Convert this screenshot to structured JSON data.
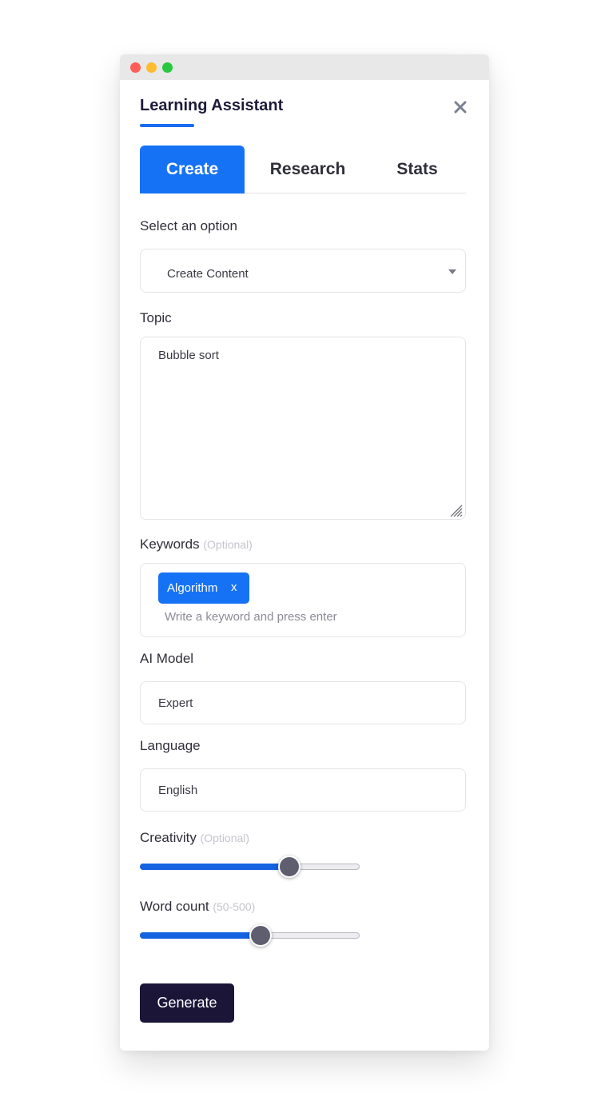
{
  "app": {
    "title": "Learning Assistant"
  },
  "tabs": [
    {
      "label": "Create",
      "active": true
    },
    {
      "label": "Research",
      "active": false
    },
    {
      "label": "Stats",
      "active": false
    }
  ],
  "form": {
    "option": {
      "label": "Select an option",
      "value": "Create Content"
    },
    "topic": {
      "label": "Topic",
      "value": "Bubble sort"
    },
    "keywords": {
      "label": "Keywords",
      "optional_note": "(Optional)",
      "chips": [
        {
          "label": "Algorithm",
          "remove": "x"
        }
      ],
      "placeholder": "Write a keyword and press enter"
    },
    "ai_model": {
      "label": "AI Model",
      "value": "Expert"
    },
    "language": {
      "label": "Language",
      "value": "English"
    },
    "creativity": {
      "label": "Creativity",
      "optional_note": "(Optional)",
      "level_fraction": 0.68
    },
    "word_count": {
      "label": "Word count",
      "range_note": "(50-500)",
      "level_fraction": 0.55
    }
  },
  "actions": {
    "generate_label": "Generate"
  },
  "colors": {
    "accent": "#1672f5",
    "button_dark": "#1b1538",
    "slider_fill": "#1463e0"
  }
}
